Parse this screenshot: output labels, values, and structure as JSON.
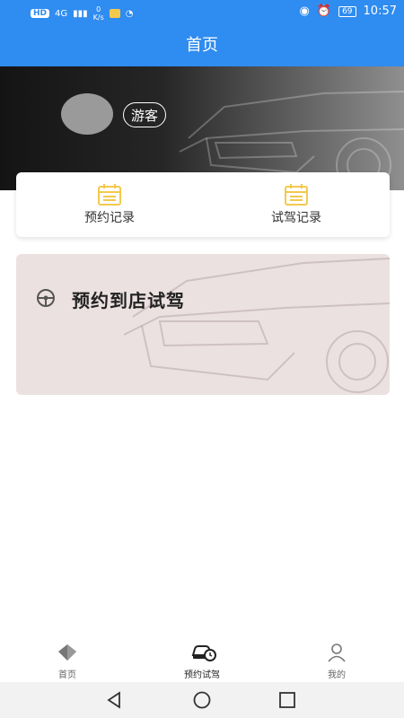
{
  "status_bar": {
    "network_badge": "HD",
    "signal": "4G",
    "speed_value": "0",
    "speed_unit": "K/s",
    "battery": "69",
    "time": "10:57"
  },
  "header": {
    "title": "首页"
  },
  "profile": {
    "guest_label": "游客"
  },
  "records": [
    {
      "label": "预约记录",
      "icon": "calendar-icon"
    },
    {
      "label": "试驾记录",
      "icon": "calendar-icon"
    }
  ],
  "booking_banner": {
    "title": "预约到店试驾",
    "icon": "steering-wheel-icon"
  },
  "bottom_nav": [
    {
      "label": "首页",
      "icon": "home-icon"
    },
    {
      "label": "预约试驾",
      "icon": "car-clock-icon",
      "active": true
    },
    {
      "label": "我的",
      "icon": "user-icon"
    }
  ],
  "colors": {
    "primary": "#2f8cf0",
    "calendar": "#f3c94d",
    "banner_bg": "#ece1e1"
  }
}
